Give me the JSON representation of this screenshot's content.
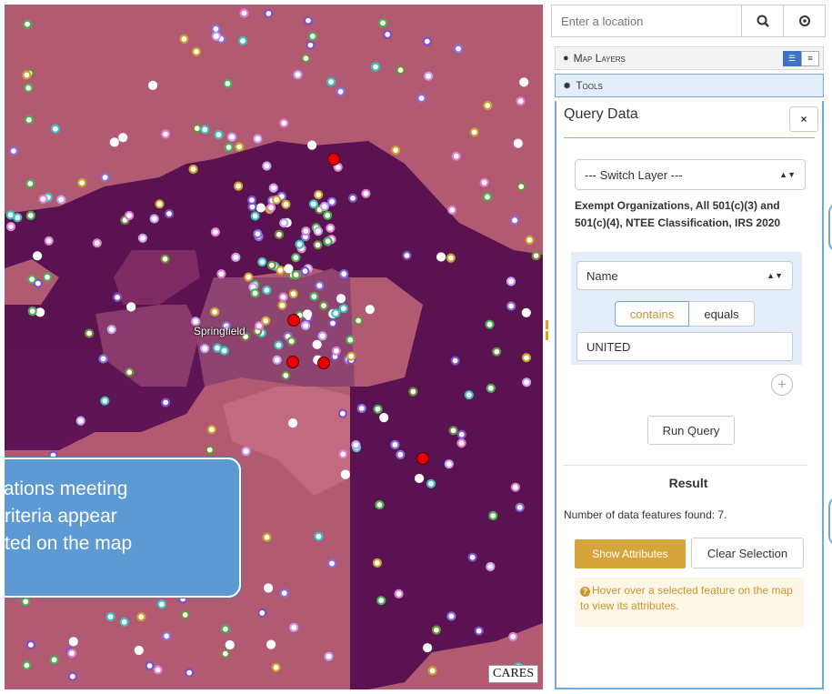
{
  "map": {
    "city_label": "Springfield",
    "logo_text": "CARES",
    "callout_lines": [
      "locations meeting",
      "e criteria appear",
      "ighted on the map"
    ],
    "colors": {
      "region_light": "#b15a72",
      "region_mid": "#7b2a5e",
      "region_dark": "#5a1250",
      "highlight": "#e60000"
    }
  },
  "search": {
    "placeholder": "Enter a location",
    "search_icon": "search-icon",
    "locate_icon": "locate-icon"
  },
  "layers_header": {
    "label": "Map Layers",
    "icon": "globe-icon"
  },
  "tools_header": {
    "label": "Tools",
    "icon": "gear-icon"
  },
  "query": {
    "title": "Query Data",
    "close_label": "×",
    "switch_layer": "--- Switch Layer ---",
    "layer_name": "Exempt Organizations, All 501(c)(3) and 501(c)(4), NTEE Classification, IRS 2020",
    "field_select": "Name",
    "op_contains": "contains",
    "op_equals": "equals",
    "value": "UNITED",
    "add_label": "+",
    "run_label": "Run Query"
  },
  "result": {
    "title": "Result",
    "count_text": "Number of data features found: 7.",
    "show_attributes": "Show Attributes",
    "clear_selection": "Clear Selection",
    "tip": "Hover over a selected feature on the map to view its attributes."
  }
}
